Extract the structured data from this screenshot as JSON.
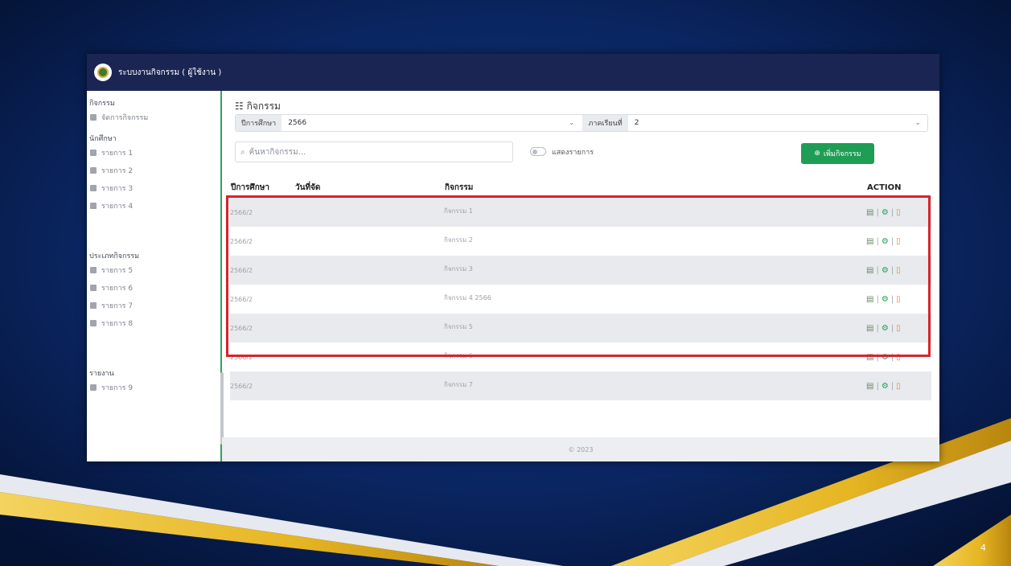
{
  "app": {
    "title": "ระบบงานกิจกรรม ( ผู้ใช้งาน )"
  },
  "sidebar": {
    "groups": [
      {
        "label": "กิจกรรม",
        "items": [
          {
            "label": "จัดการกิจกรรม"
          }
        ]
      },
      {
        "label": "นักศึกษา",
        "items": [
          {
            "label": "รายการ 1"
          },
          {
            "label": "รายการ 2"
          },
          {
            "label": "รายการ 3"
          },
          {
            "label": "รายการ 4"
          }
        ]
      },
      {
        "label": "ประเภทกิจกรรม",
        "items": [
          {
            "label": "รายการ 5"
          },
          {
            "label": "รายการ 6"
          },
          {
            "label": "รายการ 7"
          },
          {
            "label": "รายการ 8"
          }
        ]
      },
      {
        "label": "รายงาน",
        "items": [
          {
            "label": "รายการ 9"
          }
        ]
      }
    ]
  },
  "main": {
    "title": "กิจกรรม",
    "filter": {
      "year_label": "ปีการศึกษา",
      "year_value": "2566",
      "term_label": "ภาคเรียนที่",
      "term_value": "2"
    },
    "search": {
      "placeholder": "ค้นหากิจกรรม..."
    },
    "toggle_label": "แสดงรายการ",
    "add_button": "เพิ่มกิจกรรม",
    "columns": [
      "ปีการศึกษา",
      "วันที่จัด",
      "กิจกรรม",
      "ACTION"
    ],
    "rows": [
      {
        "year": "2566/2",
        "date": "",
        "date_sub": "",
        "activity": "กิจกรรม 1",
        "activity_sub": ""
      },
      {
        "year": "2566/2",
        "date": "",
        "date_sub": "",
        "activity": "กิจกรรม 2",
        "activity_sub": ""
      },
      {
        "year": "2566/2",
        "date": "",
        "date_sub": "",
        "activity": "กิจกรรม 3",
        "activity_sub": ""
      },
      {
        "year": "2566/2",
        "date": "",
        "date_sub": "",
        "activity": "กิจกรรม 4 2566",
        "activity_sub": ""
      },
      {
        "year": "2566/2",
        "date": "",
        "date_sub": "",
        "activity": "กิจกรรม 5",
        "activity_sub": ""
      },
      {
        "year": "2566/2",
        "date": "",
        "date_sub": "",
        "activity": "กิจกรรม 6",
        "activity_sub": ""
      },
      {
        "year": "2566/2",
        "date": "",
        "date_sub": "",
        "activity": "กิจกรรม 7",
        "activity_sub": ""
      }
    ],
    "footer": "© 2023"
  },
  "slide": {
    "page_number": "4"
  },
  "colors": {
    "topbar": "#1b2553",
    "accent_green": "#1f9d55",
    "highlight_red": "#d8242b",
    "background_navy": "#061a44",
    "gold": "#e8b923"
  }
}
